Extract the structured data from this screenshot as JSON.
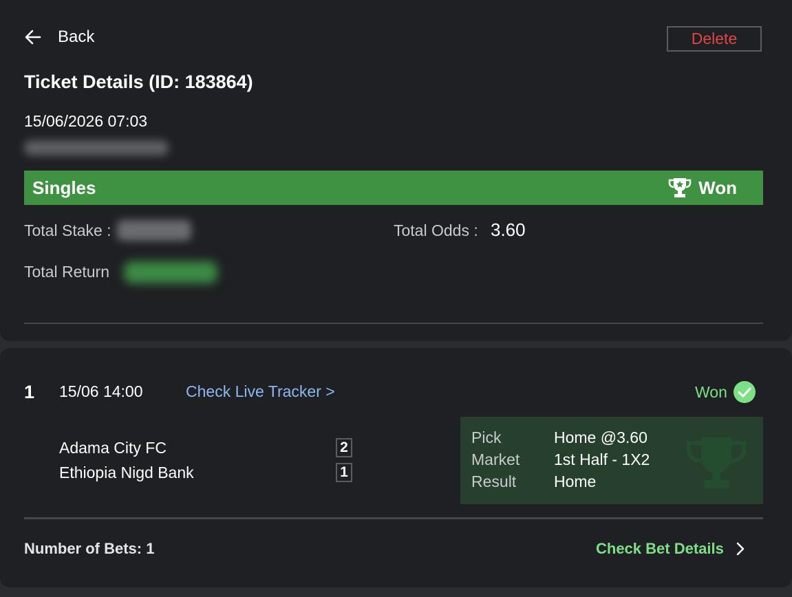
{
  "header": {
    "back_label": "Back",
    "delete_label": "Delete",
    "title": "Ticket Details (ID: 183864)",
    "datetime": "15/06/2026 07:03"
  },
  "ticket": {
    "bet_type": "Singles",
    "status": "Won",
    "stake_label": "Total Stake :",
    "odds_label": "Total Odds :",
    "odds_value": "3.60",
    "return_label": "Total Return"
  },
  "bets": [
    {
      "index": "1",
      "time": "15/06 14:00",
      "tracker_link": "Check Live Tracker >",
      "status": "Won",
      "home_team": "Adama City FC",
      "home_score": "2",
      "away_team": "Ethiopia Nigd Bank",
      "away_score": "1",
      "pick_label": "Pick",
      "pick_value": "Home @3.60",
      "market_label": "Market",
      "market_value": "1st Half - 1X2",
      "result_label": "Result",
      "result_value": "Home"
    }
  ],
  "footer": {
    "num_bets": "Number of Bets: 1",
    "check_details": "Check Bet Details"
  },
  "colors": {
    "won_green": "#3f9241",
    "won_text": "#7de086",
    "delete_red": "#e0454a",
    "link_blue": "#8fb7f0"
  }
}
